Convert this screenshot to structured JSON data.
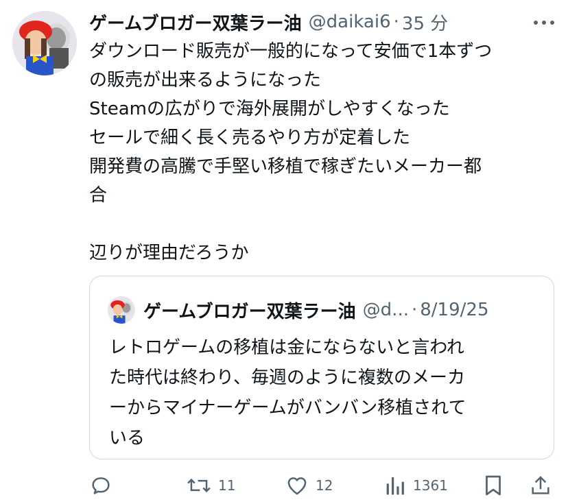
{
  "tweet": {
    "author_name": "ゲームブロガー双葉ラー油",
    "handle": "@daikai6",
    "separator": "·",
    "time": "35 分",
    "lines": [
      "ダウンロード販売が一般的になって安価で1本ずつ",
      "の販売が出来るようになった",
      "Steamの広がりで海外展開がしやすくなった",
      "セールで細く長く売るやり方が定着した",
      "開発費の高騰で手堅い移植で稼ぎたいメーカー都",
      "合",
      "",
      "辺りが理由だろうか"
    ]
  },
  "quote": {
    "author_name": "ゲームブロガー双葉ラー油",
    "handle": "@d...",
    "separator": "·",
    "date": "8/19/25",
    "lines": [
      "レトロゲームの移植は金にならないと言われ",
      "た時代は終わり、毎週のように複数のメーカ",
      "ーからマイナーゲームがバンバン移植されて",
      "いる"
    ]
  },
  "actions": {
    "reply_icon": "reply-icon",
    "retweet_count": "11",
    "like_count": "12",
    "views_count": "1361",
    "bookmark_icon": "bookmark-icon",
    "share_icon": "share-icon"
  },
  "colors": {
    "text": "#0f1419",
    "secondary": "#536471",
    "border": "#cfd9de"
  }
}
